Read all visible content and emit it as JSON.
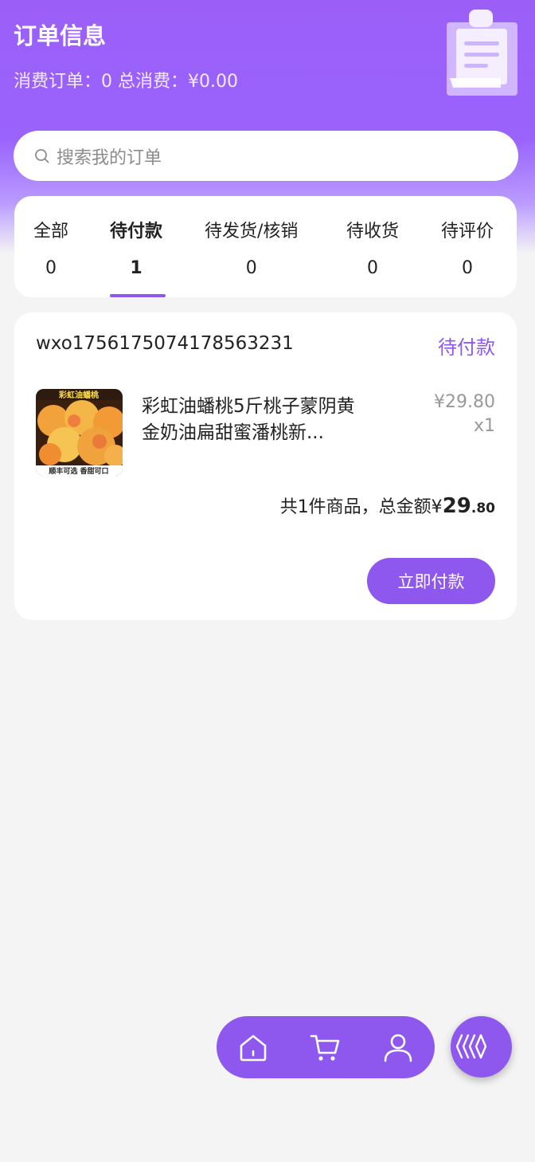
{
  "header": {
    "title": "订单信息",
    "summary": "消费订单：0 总消费：¥0.00",
    "clipboard_icon": "clipboard-icon"
  },
  "search": {
    "icon": "search-icon",
    "placeholder": "搜索我的订单"
  },
  "tabs": [
    {
      "label": "全部",
      "count": "0"
    },
    {
      "label": "待付款",
      "count": "1"
    },
    {
      "label": "待发货/核销",
      "count": "0"
    },
    {
      "label": "待收货",
      "count": "0"
    },
    {
      "label": "待评价",
      "count": "0"
    }
  ],
  "active_tab": "待付款",
  "order": {
    "order_no": "wxo1756175074178563231",
    "status": "待付款",
    "product": {
      "image_banner_top": "彩虹油蟠桃",
      "image_banner_bottom": "顺丰可选 香甜可口",
      "name": "彩虹油蟠桃5斤桃子蒙阴黄金奶油扁甜蜜潘桃新...",
      "price": "¥29.80",
      "qty": "x1"
    },
    "total_prefix": "共1件商品，总金额¥",
    "total_int": "29",
    "total_dec": ".80",
    "pay_button": "立即付款"
  },
  "bottom_nav": {
    "items": [
      "home-icon",
      "cart-icon",
      "user-icon"
    ],
    "fab_icon": "waves-icon"
  },
  "colors": {
    "accent": "#8e58ee",
    "header_bg": "#9b5ff8",
    "page_bg": "#f4f4f4"
  }
}
